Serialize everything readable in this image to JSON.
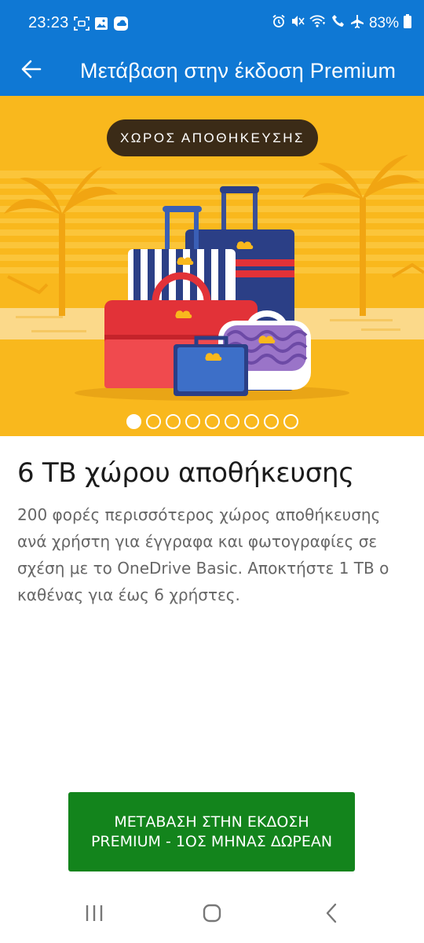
{
  "status_bar": {
    "time": "23:23",
    "battery": "83%",
    "left_icons": [
      "screenshot-icon",
      "gallery-icon",
      "app-notification-icon"
    ],
    "right_icons": [
      "alarm-icon",
      "mute-icon",
      "wifi-calling-icon",
      "call-icon",
      "airplane-icon",
      "battery-icon"
    ]
  },
  "app_bar": {
    "title": "Μετάβαση στην έκδοση Premium",
    "back_icon": "back-arrow-icon",
    "background": "#0f78d4"
  },
  "hero": {
    "chip_label": "ΧΩΡΟΣ ΑΠΟΘΗΚΕΥΣΗΣ",
    "background": "#f9b81d",
    "pager": {
      "total": 9,
      "active_index": 0
    }
  },
  "content": {
    "title": "6 TB χώρου αποθήκευσης",
    "body": "200 φορές περισσότερος χώρος αποθήκευσης ανά χρήστη για έγγραφα και φωτογραφίες σε σχέση με το OneDrive Basic. Αποκτήστε 1 TB ο καθένας για έως 6 χρήστες."
  },
  "cta": {
    "label": "ΜΕΤΑΒΑΣΗ ΣΤΗΝ ΕΚΔΟΣΗ PREMIUM - 1ΟΣ ΜΗΝΑΣ ΔΩΡΕΑΝ",
    "color": "#13841c"
  },
  "nav_bar": {
    "buttons": [
      "recent-apps-icon",
      "home-icon",
      "back-icon"
    ]
  }
}
